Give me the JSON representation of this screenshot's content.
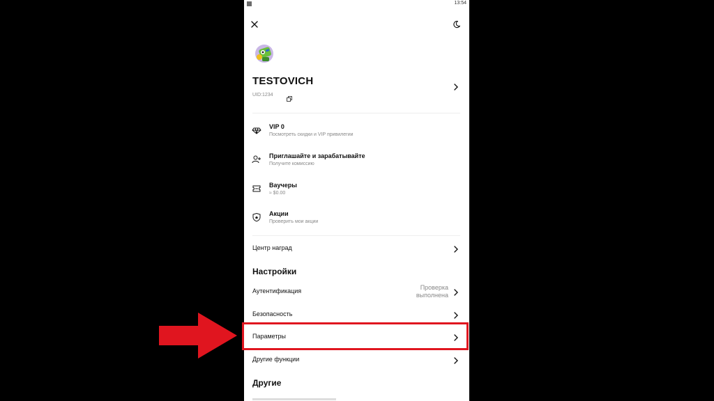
{
  "status_bar": {
    "time": "13:54"
  },
  "profile": {
    "username": "TESTOVICH",
    "uid": "UID:1234"
  },
  "menu": [
    {
      "title": "VIP 0",
      "subtitle": "Посмотреть скидки и VIP привилегии",
      "icon": "diamond-icon"
    },
    {
      "title": "Приглашайте и зарабатывайте",
      "subtitle": "Получите комиссию",
      "icon": "add-user-icon"
    },
    {
      "title": "Ваучеры",
      "subtitle": "≈ $0.00",
      "icon": "ticket-icon"
    },
    {
      "title": "Акции",
      "subtitle": "Проверить мои акции",
      "icon": "shield-icon"
    }
  ],
  "rewards_center": "Центр наград",
  "settings": {
    "title": "Настройки",
    "authentication": {
      "label": "Аутентификация",
      "value_line1": "Проверка",
      "value_line2": "выполнена"
    },
    "security": "Безопасность",
    "parameters": "Параметры",
    "other_functions": "Другие функции"
  },
  "other": {
    "title": "Другие"
  },
  "colors": {
    "highlight": "#e0151f",
    "arrow": "#e0151f"
  }
}
